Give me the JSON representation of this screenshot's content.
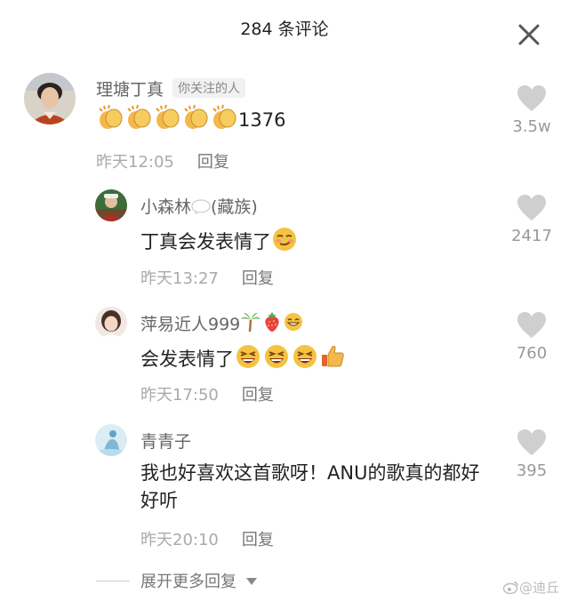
{
  "header": {
    "title": "284 条评论"
  },
  "comments": [
    {
      "name": "理塘丁真",
      "tag": "你关注的人",
      "text": "1376",
      "time": "昨天12:05",
      "reply": "回复",
      "likes": "3.5w"
    },
    {
      "name": "小森林",
      "name_suffix": "(藏族)",
      "text": "丁真会发表情了",
      "time": "昨天13:27",
      "reply": "回复",
      "likes": "2417"
    },
    {
      "name": "萍易近人999",
      "text": "会发表情了",
      "time": "昨天17:50",
      "reply": "回复",
      "likes": "760"
    },
    {
      "name": "青青子",
      "text": "我也好喜欢这首歌呀！ANU的歌真的都好好听",
      "time": "昨天20:10",
      "reply": "回复",
      "likes": "395"
    }
  ],
  "expand": {
    "label": "展开更多回复"
  },
  "watermark": {
    "text": "@迪丘"
  },
  "icons": {
    "close": "close-icon",
    "like": "heart-icon",
    "clap": "clapping-hands-emoji",
    "smirk": "smirk-emoji",
    "grin": "laughing-emoji",
    "thumb": "thumbs-up-emoji",
    "palm": "palm-tree-emoji",
    "strawberry": "strawberry-emoji",
    "bubble": "speech-bubble-emoji",
    "weibo": "weibo-icon"
  },
  "colors": {
    "heart": "#cfcfcf",
    "emoji": "#f5c342",
    "text": "#222222",
    "muted": "#999999"
  }
}
